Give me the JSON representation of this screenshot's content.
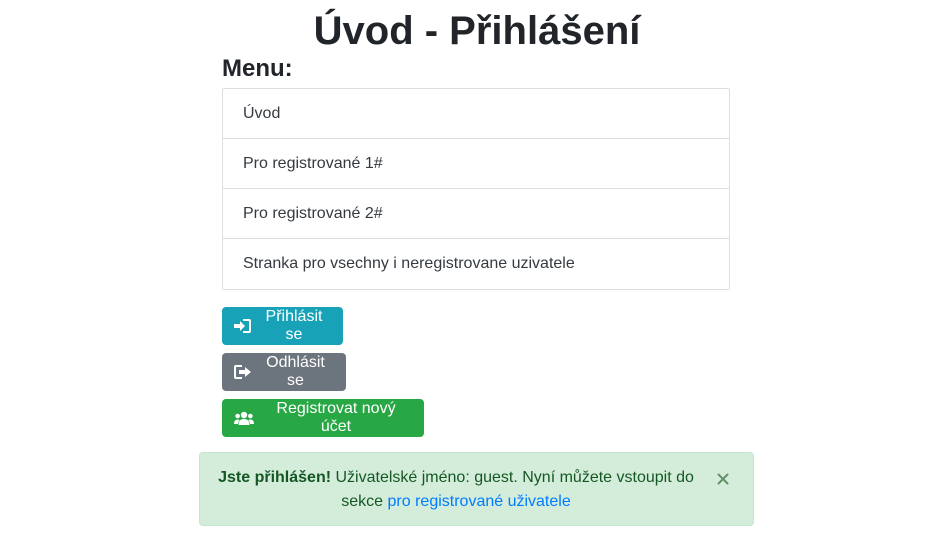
{
  "page": {
    "title": "Úvod - Přihlášení"
  },
  "menu": {
    "heading": "Menu:",
    "items": [
      {
        "label": "Úvod"
      },
      {
        "label": "Pro registrované 1#"
      },
      {
        "label": "Pro registrované 2#"
      },
      {
        "label": "Stranka pro vsechny i neregistrovane uzivatele"
      }
    ]
  },
  "buttons": {
    "login": {
      "label": "Přihlásit se",
      "icon": "sign-in-icon",
      "color": "#17a2b8"
    },
    "logout": {
      "label": "Odhlásit se",
      "icon": "sign-out-icon",
      "color": "#6c757d"
    },
    "register": {
      "label": "Registrovat nový účet",
      "icon": "users-icon",
      "color": "#28a745"
    }
  },
  "alert": {
    "strong": "Jste přihlášen!",
    "text": " Uživatelské jméno: guest. Nyní můžete vstoupit do sekce ",
    "link": "pro registrované uživatele",
    "close": "×",
    "background": "#d4edda",
    "link_color": "#007bff"
  }
}
